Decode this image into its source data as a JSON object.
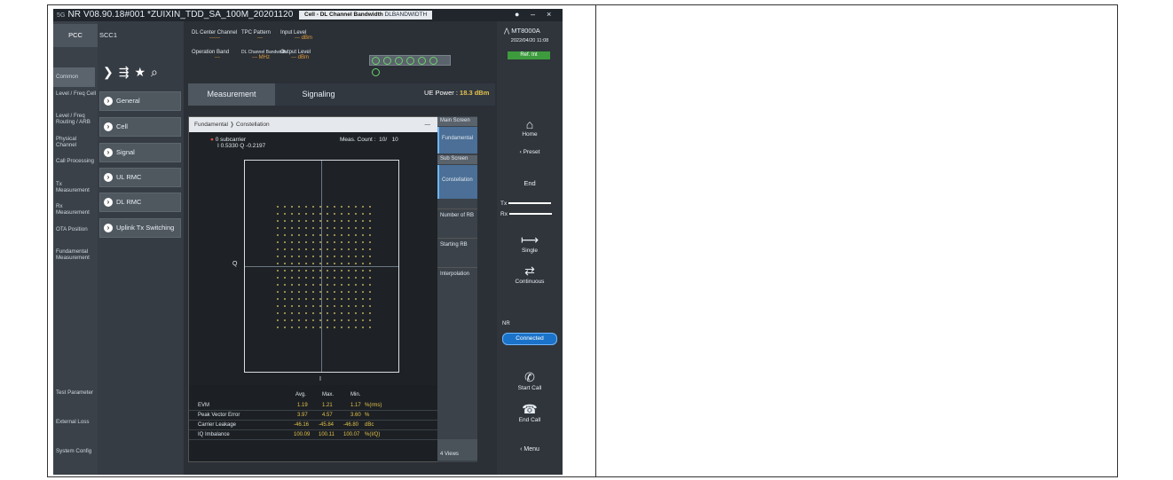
{
  "window": {
    "title": "NR V08.90.18#001 *ZUIXIN_TDD_SA_100M_20201120",
    "title_prefix": "5G",
    "dialog_tab": "Cell - DL Channel Bandwidth",
    "dialog_tab_suffix": "DLBANDWIDTH"
  },
  "carrier_tabs": {
    "pcc": "PCC",
    "scc": "SCC1"
  },
  "toolbar_icons": [
    "chevron-icon",
    "import-icon",
    "star-icon",
    "search-icon"
  ],
  "left_categories": [
    "Common",
    "Level / Freq Cell",
    "Level / Freq Routing / ARB",
    "Physical Channel",
    "Call Processing",
    "Tx Measurement",
    "Rx Measurement",
    "OTA Position",
    "Fundamental Measurement",
    "Test Parameter",
    "External Loss",
    "System Config"
  ],
  "menu_buttons": [
    "General",
    "Cell",
    "Signal",
    "UL RMC",
    "DL RMC",
    "Uplink Tx Switching"
  ],
  "header_params": {
    "dl_center_channel": {
      "label": "DL Center Channel",
      "value": "------"
    },
    "tpc_pattern": {
      "label": "TPC Pattern",
      "value": "---"
    },
    "input_level": {
      "label": "Input Level",
      "value": "--- dBm"
    },
    "operation_band": {
      "label": "Operation Band",
      "value": "---"
    },
    "dl_channel_bandwidth": {
      "label": "DL Channel Bandwidth",
      "value": "--- MHz"
    },
    "output_level": {
      "label": "Output Level",
      "value": "--- dBm"
    }
  },
  "main_tabs": {
    "measurement": "Measurement",
    "signaling": "Signaling"
  },
  "ue_power": {
    "label": "UE Power :",
    "value": "18.3 dBm"
  },
  "panel": {
    "breadcrumb_root": "Fundamental",
    "breadcrumb_leaf": "Constellation",
    "marker_label": "0 subcarrier",
    "marker_value": "I 0.5330  Q -0.2197",
    "meas_count_label": "Meas. Count :",
    "meas_count_value": "10/",
    "meas_count_total": "10",
    "axis_q": "Q",
    "axis_i": "I"
  },
  "results": {
    "headers": [
      "Avg.",
      "Max.",
      "Min."
    ],
    "rows": [
      {
        "label": "EVM",
        "avg": "1.19",
        "max": "1.21",
        "min": "1.17",
        "unit": "%(rms)"
      },
      {
        "label": "Peak Vector Error",
        "avg": "3.97",
        "max": "4.57",
        "min": "3.60",
        "unit": "%"
      },
      {
        "label": "Carrier Leakage",
        "avg": "-46.16",
        "max": "-45.84",
        "min": "-46.80",
        "unit": "dBc"
      },
      {
        "label": "IQ Imbalance",
        "avg": "100.09",
        "max": "100.11",
        "min": "100.07",
        "unit": "%(I/Q)"
      }
    ]
  },
  "side_menu": {
    "main_screen": "Main Screen",
    "fundamental": "Fundamental",
    "sub_screen": "Sub Screen",
    "constellation": "Constellation",
    "number_of_rb": "Number of RB",
    "starting_rb": "Starting RB",
    "interpolation": "Interpolation",
    "views": "4 Views"
  },
  "right_panel": {
    "brand": "MT8000A",
    "datetime": "2022/04/20 11:08",
    "ref_int": "Ref. Int",
    "home": "Home",
    "preset": "Preset",
    "end": "End",
    "tx": "Tx",
    "rx": "Rx",
    "single": "Single",
    "continuous": "Continuous",
    "nr": "NR",
    "connected": "Connected",
    "start_call": "Start Call",
    "end_call": "End Call",
    "menu": "Menu"
  }
}
